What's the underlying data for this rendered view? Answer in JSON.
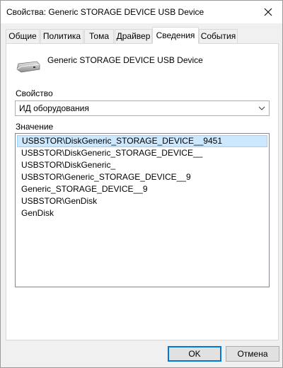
{
  "window": {
    "title": "Свойства: Generic STORAGE DEVICE USB Device",
    "close_icon": "close-icon"
  },
  "tabs": [
    {
      "label": "Общие",
      "active": false
    },
    {
      "label": "Политика",
      "active": false
    },
    {
      "label": "Тома",
      "active": false
    },
    {
      "label": "Драйвер",
      "active": false
    },
    {
      "label": "Сведения",
      "active": true
    },
    {
      "label": "События",
      "active": false
    }
  ],
  "details": {
    "device_icon": "usb-drive-icon",
    "device_name": "Generic STORAGE DEVICE USB Device",
    "property_label": "Свойство",
    "property_selected": "ИД оборудования",
    "value_label": "Значение",
    "values": [
      "USBSTOR\\DiskGeneric_STORAGE_DEVICE__9451",
      "USBSTOR\\DiskGeneric_STORAGE_DEVICE__",
      "USBSTOR\\DiskGeneric_",
      "USBSTOR\\Generic_STORAGE_DEVICE__9",
      "Generic_STORAGE_DEVICE__9",
      "USBSTOR\\GenDisk",
      "GenDisk"
    ],
    "selected_value": "USBSTOR\\DiskGeneric_STORAGE_DEVICE__9451"
  },
  "buttons": {
    "ok": "OK",
    "cancel": "Отмена"
  },
  "colors": {
    "selection_bg": "#cce8ff",
    "selection_border": "#99d1ff",
    "default_button_border": "#0078d7"
  }
}
